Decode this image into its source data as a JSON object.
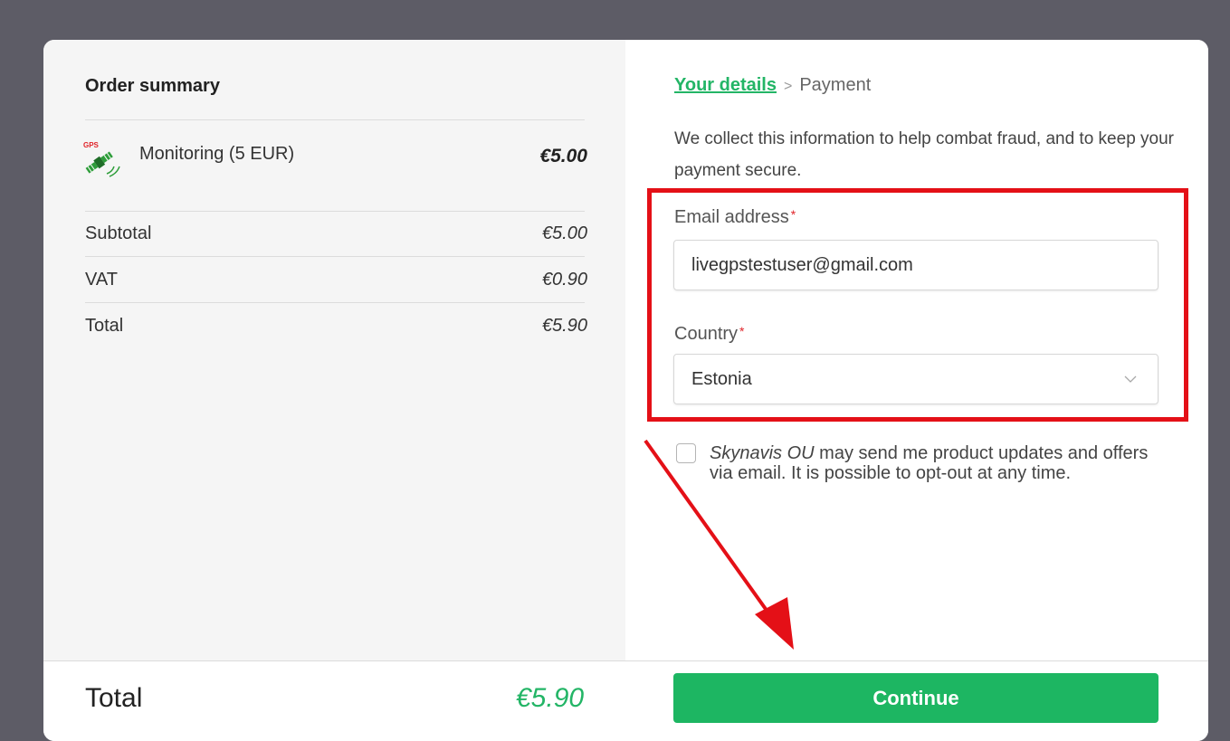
{
  "order_summary": {
    "title": "Order summary",
    "product": {
      "name": "Monitoring (5 EUR)",
      "price": "€5.00",
      "icon": "gps-satellite-icon",
      "icon_text": "GPS"
    },
    "subtotal": {
      "label": "Subtotal",
      "value": "€5.00"
    },
    "vat": {
      "label": "VAT",
      "value": "€0.90"
    },
    "total": {
      "label": "Total",
      "value": "€5.90"
    }
  },
  "checkout": {
    "breadcrumb": {
      "current": "Your details",
      "next": "Payment",
      "separator": ">"
    },
    "info_text": "We collect this information to help combat fraud, and to keep your payment secure.",
    "email": {
      "label": "Email address",
      "value": "livegpstestuser@gmail.com",
      "required_mark": "*"
    },
    "country": {
      "label": "Country",
      "value": "Estonia",
      "required_mark": "*"
    },
    "consent": {
      "checked": false,
      "company": "Skynavis OU",
      "text": "may send me product updates and offers via email. It is possible to opt-out at any time."
    }
  },
  "footer": {
    "total_label": "Total",
    "total_value": "€5.90",
    "continue_label": "Continue"
  },
  "colors": {
    "accent_green": "#1db662",
    "highlight_red": "#e41017",
    "backdrop": "#5d5c66"
  }
}
